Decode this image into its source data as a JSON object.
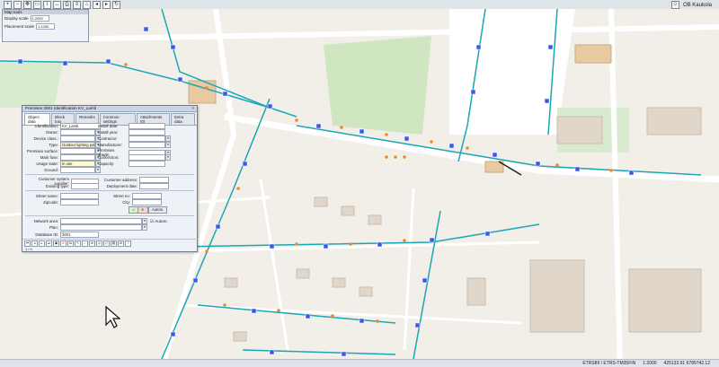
{
  "app": {
    "title": "Map tools"
  },
  "topbar": {
    "icons": [
      "zoom-in-icon",
      "zoom-out-icon",
      "pan-icon",
      "select-icon",
      "info-icon",
      "measure-icon",
      "print-icon",
      "layers-icon",
      "home-icon",
      "back-icon",
      "forward-icon",
      "refresh-icon"
    ]
  },
  "user": {
    "name": "OB Kaukola"
  },
  "mapbox": {
    "title": "Map tools",
    "display_scale_label": "Display scale",
    "display_scale_value": "1:2000",
    "placement_scale_label": "Placement scale",
    "placement_scale_value": "1:1000"
  },
  "dialog": {
    "title": "Premises 3001 Identification KV_Lamb",
    "tabs": [
      "Object data",
      "Block box",
      "Remarks",
      "Common settings",
      "Attachments (0)",
      "Extra data"
    ],
    "fields": {
      "identification": {
        "label": "Identification:",
        "value": "KV_Lamb"
      },
      "owner": {
        "label": "Owner:",
        "value": ""
      },
      "device_cl": {
        "label": "Device class.:",
        "value": ""
      },
      "type": {
        "label": "Type:",
        "value": "Outdoor lighting pole"
      },
      "premises_surface": {
        "label": "Premises surface:",
        "value": ""
      },
      "main_fuse": {
        "label": "Main fuse:",
        "value": ""
      },
      "usage_state": {
        "label": "Usage state:",
        "value": "In use"
      },
      "ground": {
        "label": "Ground:",
        "value": ""
      },
      "install_date": {
        "label": "Install date:",
        "value": ""
      },
      "install_year": {
        "label": "Install year:",
        "value": ""
      },
      "contractor": {
        "label": "Contractor:",
        "value": ""
      },
      "manufacturer": {
        "label": "Manufacturer:",
        "value": ""
      },
      "premises_shade": {
        "label": "Premises shade:",
        "value": ""
      },
      "connection": {
        "label": "Connection:",
        "value": ""
      },
      "capacity": {
        "label": "Capacity:",
        "value": ""
      },
      "customer_supplier": {
        "label": "Customer system supplier:",
        "value": ""
      },
      "customer_address": {
        "label": "Customer address:",
        "value": ""
      },
      "existing_type": {
        "label": "Existing type:",
        "value": ""
      },
      "deployment_date": {
        "label": "Deployment date:",
        "value": ""
      },
      "street_name": {
        "label": "Street name:",
        "value": ""
      },
      "street_no": {
        "label": "Street no:",
        "value": ""
      },
      "zip_code": {
        "label": "Zipcode:",
        "value": ""
      },
      "city": {
        "label": "City:",
        "value": ""
      },
      "network_area": {
        "label": "Network area:",
        "value": ""
      },
      "plan": {
        "label": "Plan:",
        "value": ""
      },
      "database_id": {
        "label": "Database ID:",
        "value": "3001"
      }
    },
    "autom_label": "Autom.",
    "autom_button_label": "Autom.",
    "footer": "1 / 4"
  },
  "statusbar": {
    "crs": "ETRS89 / ETRS-TM35FIN",
    "zoom": "1:2000",
    "coords": "425133.91 6789742.12"
  },
  "colors": {
    "accent": "#1aa7b5",
    "road": "#ffffff",
    "green": "#cfe6c1"
  }
}
